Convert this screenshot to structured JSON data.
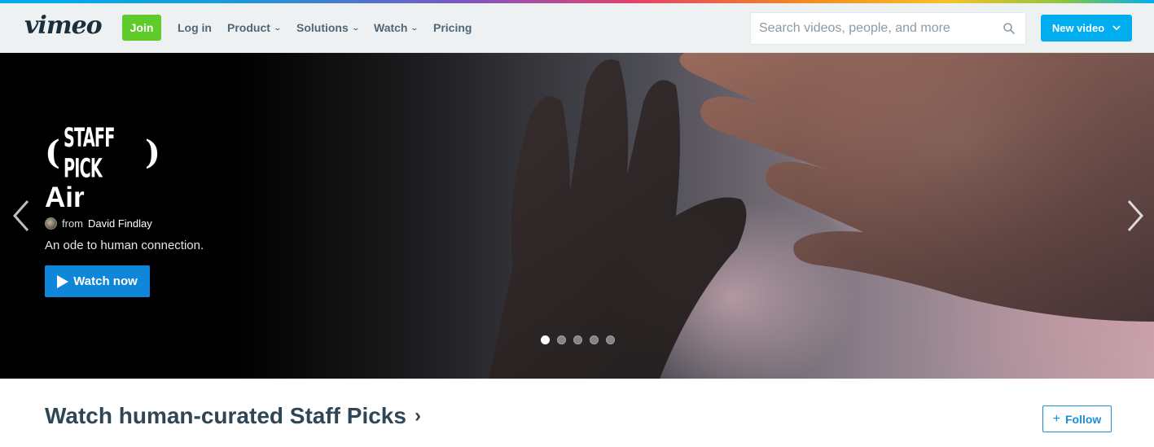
{
  "header": {
    "logo": "vimeo",
    "join_label": "Join",
    "nav": [
      {
        "label": "Log in",
        "dropdown": false
      },
      {
        "label": "Product",
        "dropdown": true
      },
      {
        "label": "Solutions",
        "dropdown": true
      },
      {
        "label": "Watch",
        "dropdown": true
      },
      {
        "label": "Pricing",
        "dropdown": false
      }
    ],
    "search_placeholder": "Search videos, people, and more",
    "new_video_label": "New video"
  },
  "hero": {
    "badge": "STAFF PICK",
    "title": "Air",
    "from_label": "from",
    "author": "David Findlay",
    "description": "An ode to human connection.",
    "watch_label": "Watch now",
    "slide_count": 5,
    "active_slide": 1
  },
  "section": {
    "title": "Watch human-curated Staff Picks",
    "caret": "›",
    "follow_label": "Follow",
    "follow_icon": "+"
  },
  "colors": {
    "brand_blue": "#00adef",
    "join_green": "#5ecb2a",
    "watch_blue": "#0f86d9",
    "heading": "#2f4656"
  },
  "icons": [
    "search-icon",
    "chevron-down-icon",
    "play-icon",
    "arrow-left-icon",
    "arrow-right-icon",
    "plus-icon"
  ]
}
